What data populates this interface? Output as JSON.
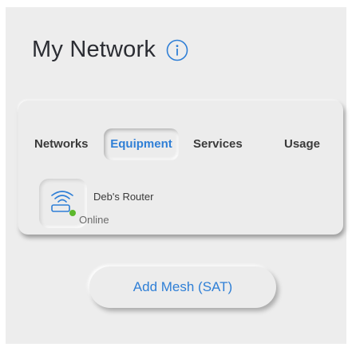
{
  "header": {
    "title": "My Network",
    "info_icon": "info-icon"
  },
  "tabs": [
    {
      "label": "Networks",
      "selected": false
    },
    {
      "label": "Equipment",
      "selected": true
    },
    {
      "label": "Services",
      "selected": false
    },
    {
      "label": "Usage",
      "selected": false
    }
  ],
  "equipment": {
    "device_name": "Deb's Router",
    "status": "Online",
    "status_color": "#5cb82c",
    "icon": "router-wifi-icon"
  },
  "actions": {
    "add_mesh_label": "Add Mesh (SAT)"
  },
  "colors": {
    "accent": "#2f7fd6",
    "background": "#ededed"
  }
}
